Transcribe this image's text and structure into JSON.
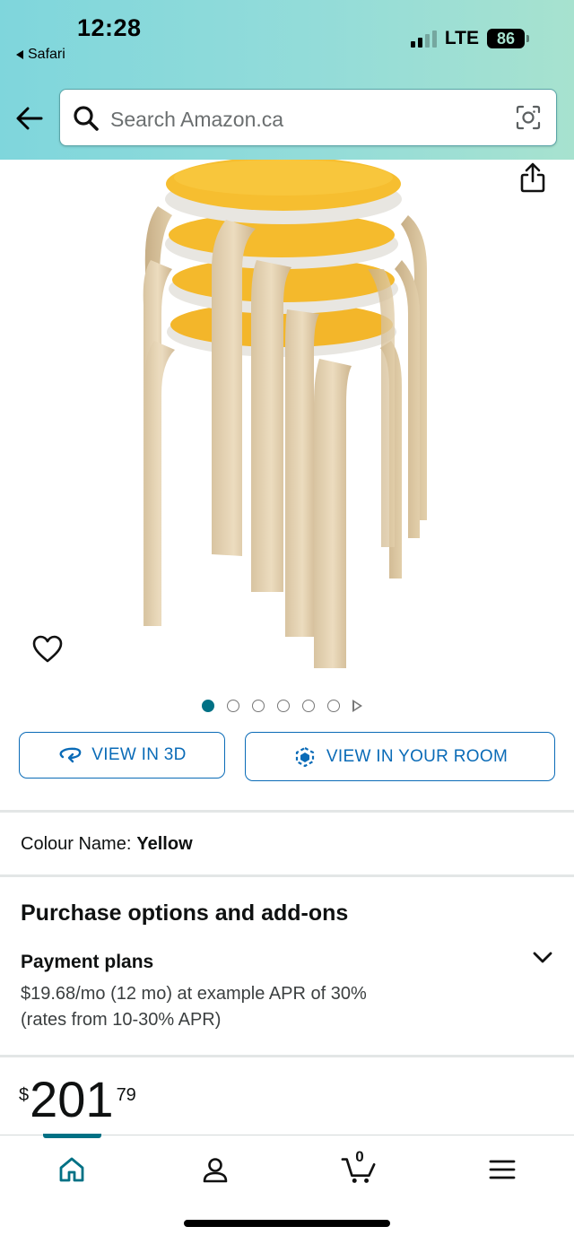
{
  "status_bar": {
    "time": "12:28",
    "back_app": "Safari",
    "network": "LTE",
    "battery": "86"
  },
  "search": {
    "placeholder": "Search Amazon.ca"
  },
  "gallery": {
    "image_count": 6,
    "active_index": 0,
    "product_color": "#f5b82a"
  },
  "actions": {
    "view_3d": "VIEW IN 3D",
    "view_room": "VIEW IN YOUR ROOM"
  },
  "variant": {
    "label": "Colour Name:",
    "value": "Yellow"
  },
  "purchase": {
    "title": "Purchase options and add-ons",
    "payment_title": "Payment plans",
    "payment_line1": "$19.68/mo (12 mo) at example APR of 30%",
    "payment_line2": "(rates from 10-30% APR)"
  },
  "price": {
    "currency": "$",
    "whole": "201",
    "fraction": "79"
  },
  "bottom_nav": {
    "cart_count": "0",
    "items": [
      "home-icon",
      "account-icon",
      "cart-icon",
      "menu-icon"
    ],
    "accent": "#007185"
  },
  "colors": {
    "link_blue": "#0a6bb7",
    "teal": "#007185"
  }
}
